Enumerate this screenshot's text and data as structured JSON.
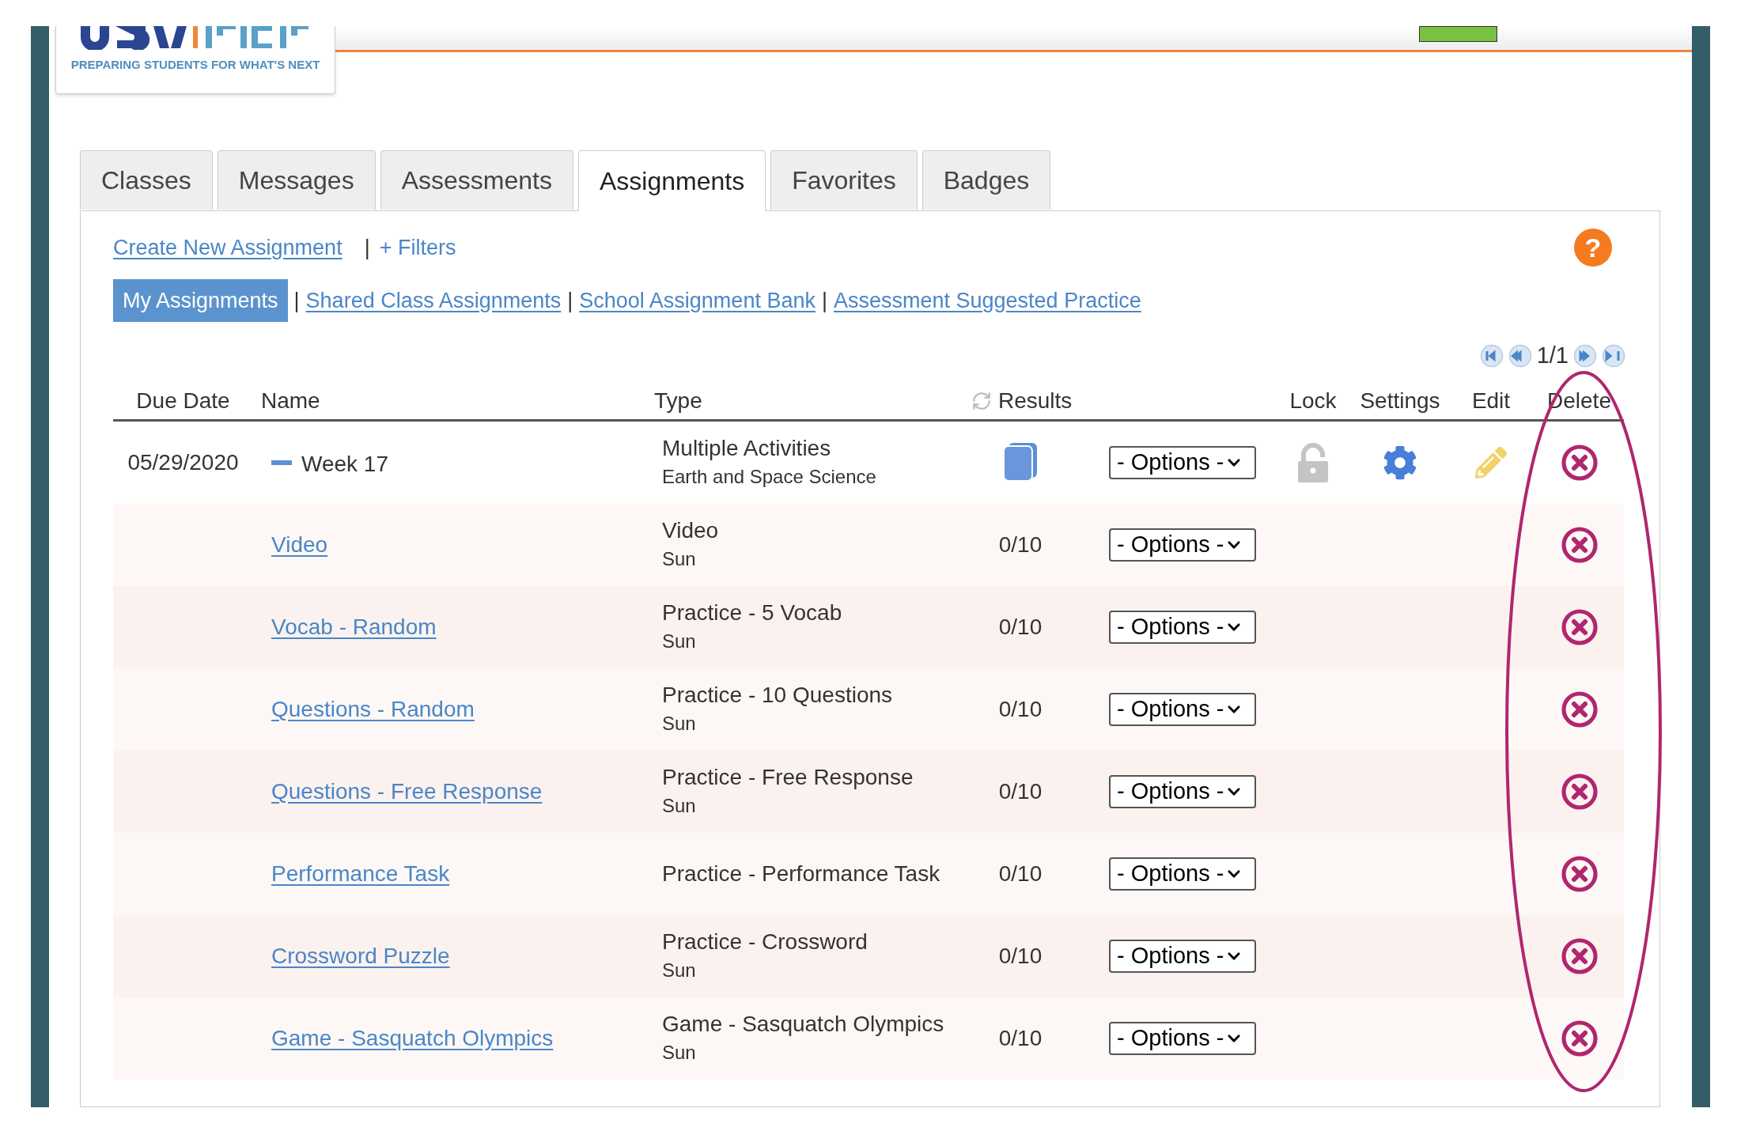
{
  "logo": {
    "tagline": "PREPARING STUDENTS FOR WHAT'S NEXT"
  },
  "tabs": [
    {
      "label": "Classes",
      "selected": false
    },
    {
      "label": "Messages",
      "selected": false
    },
    {
      "label": "Assessments",
      "selected": false
    },
    {
      "label": "Assignments",
      "selected": true
    },
    {
      "label": "Favorites",
      "selected": false
    },
    {
      "label": "Badges",
      "selected": false
    }
  ],
  "actions": [
    {
      "label": "Create New Assignment",
      "kind": "link"
    },
    {
      "label": "+ Filters",
      "kind": "plain",
      "separator": "|"
    }
  ],
  "help": {
    "label": "?"
  },
  "views": [
    {
      "label": "My Assignments",
      "selected": true
    },
    {
      "label": "Shared Class Assignments",
      "selected": false,
      "separator": "|"
    },
    {
      "label": "School Assignment Bank",
      "selected": false,
      "separator": "|"
    },
    {
      "label": "Assessment Suggested Practice",
      "selected": false,
      "separator": "|"
    }
  ],
  "pagination": {
    "text": "1/1"
  },
  "table": {
    "columns": [
      "Due Date",
      "Name",
      "Type",
      "Results",
      "Lock",
      "Settings",
      "Edit",
      "Delete"
    ],
    "rows": [
      {
        "kind": "group",
        "due_date": "05/29/2020",
        "name": "Week 17",
        "expanded": true,
        "type": "Multiple Activities",
        "subtype": "Earth and Space Science",
        "options": "- Options -",
        "locked": false
      },
      {
        "kind": "item",
        "name": "Video",
        "type": "Video",
        "subtype": "Sun",
        "results": "0/10",
        "options": "- Options -"
      },
      {
        "kind": "item",
        "name": "Vocab - Random",
        "type": "Practice - 5 Vocab",
        "subtype": "Sun",
        "results": "0/10",
        "options": "- Options -"
      },
      {
        "kind": "item",
        "name": "Questions - Random",
        "type": "Practice - 10 Questions",
        "subtype": "Sun",
        "results": "0/10",
        "options": "- Options -"
      },
      {
        "kind": "item",
        "name": "Questions - Free Response",
        "type": "Practice - Free Response",
        "subtype": "Sun",
        "results": "0/10",
        "options": "- Options -"
      },
      {
        "kind": "item",
        "name": "Performance Task",
        "type": "Practice - Performance Task",
        "results": "0/10",
        "options": "- Options -"
      },
      {
        "kind": "item",
        "name": "Crossword Puzzle",
        "type": "Practice - Crossword",
        "subtype": "Sun",
        "results": "0/10",
        "options": "- Options -"
      },
      {
        "kind": "item",
        "name": "Game - Sasquatch Olympics",
        "type": "Game - Sasquatch Olympics",
        "subtype": "Sun",
        "results": "0/10",
        "options": "- Options -"
      }
    ]
  }
}
